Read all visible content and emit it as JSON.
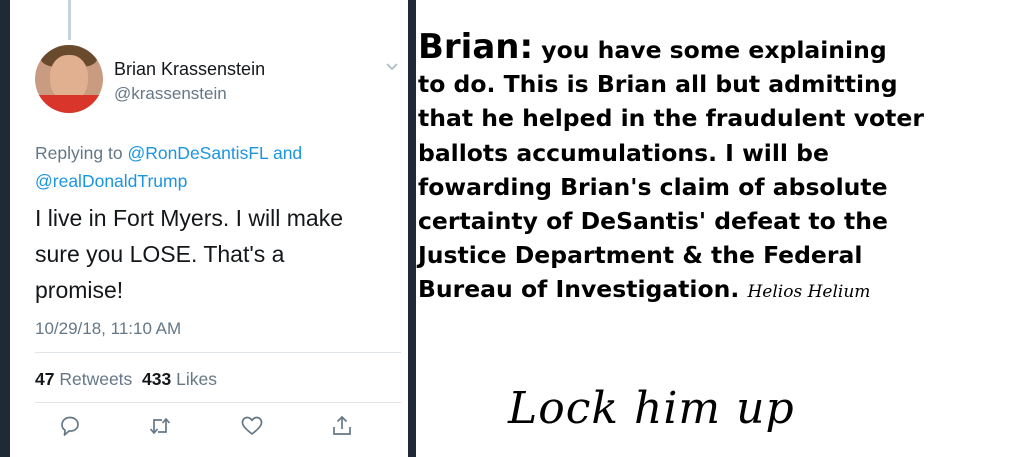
{
  "tweet": {
    "author_name": "Brian Krassenstein",
    "handle": "@krassenstein",
    "replying_prefix": "Replying to",
    "mention_1": "@RonDeSantisFL",
    "and_word": "and",
    "mention_2": "@realDonaldTrump",
    "body_line_1": "I live in Fort Myers.  I will make",
    "body_line_2": "sure you LOSE.  That's a",
    "body_line_3": "promise!",
    "timestamp": "10/29/18, 11:10 AM",
    "retweets_count": "47",
    "retweets_label": "Retweets",
    "likes_count": "433",
    "likes_label": "Likes",
    "icons": [
      "reply-icon",
      "retweet-icon",
      "like-icon",
      "share-icon"
    ]
  },
  "statement": {
    "lead": "Brian:",
    "line_1": "you have some explaining",
    "line_2": "to do. This is Brian all but admitting",
    "line_3": "that he helped in the fraudulent voter",
    "line_4": "ballots accumulations. I will be",
    "line_5": "fowarding Brian's claim of absolute",
    "line_6": "certainty of DeSantis' defeat to the",
    "line_7": "Justice Department & the Federal",
    "line_8": "Bureau of Investigation.",
    "signature": "Helios Helium",
    "footer": "Lock him up"
  },
  "colors": {
    "frame": "#1f2a36",
    "link_blue": "#1b95e0",
    "secondary_gray": "#657786",
    "text_dark": "#14171a"
  }
}
